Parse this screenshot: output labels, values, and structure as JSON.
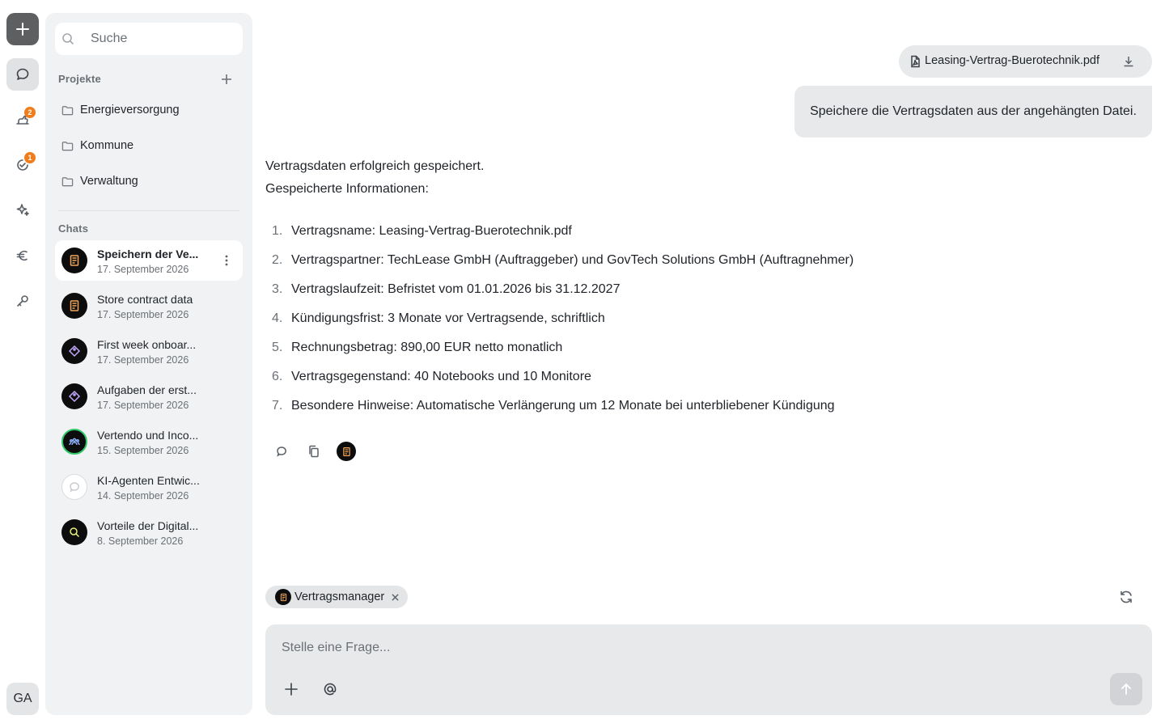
{
  "rail": {
    "badges": {
      "item2": "2",
      "item3": "1"
    },
    "user_initials": "GA"
  },
  "sidebar": {
    "search_placeholder": "Suche",
    "projects_title": "Projekte",
    "projects": [
      {
        "name": "Energieversorgung"
      },
      {
        "name": "Kommune"
      },
      {
        "name": "Verwaltung"
      }
    ],
    "chats_title": "Chats",
    "chats": [
      {
        "title": "Speichern der Ve...",
        "date": "17. September 2026",
        "icon": "contract-icon"
      },
      {
        "title": "Store contract data",
        "date": "17. September 2026",
        "icon": "contract-icon"
      },
      {
        "title": "First week onboar...",
        "date": "17. September 2026",
        "icon": "tag-icon"
      },
      {
        "title": "Aufgaben der erst...",
        "date": "17. September 2026",
        "icon": "tag-icon"
      },
      {
        "title": "Vertendo und Inco...",
        "date": "15. September 2026",
        "icon": "team-icon"
      },
      {
        "title": "KI-Agenten Entwic...",
        "date": "14. September 2026",
        "icon": "chat-icon"
      },
      {
        "title": "Vorteile der Digital...",
        "date": "8. September 2026",
        "icon": "magnifier-icon"
      }
    ]
  },
  "conversation": {
    "attachment_name": "Leasing-Vertrag-Buerotechnik.pdf",
    "user_message": "Speichere die Vertragsdaten aus der angehängten Datei.",
    "reply_line1": "Vertragsdaten erfolgreich gespeichert.",
    "reply_line2": "Gespeicherte Informationen:",
    "reply_items": [
      {
        "num": "1.",
        "text": "Vertragsname: Leasing-Vertrag-Buerotechnik.pdf"
      },
      {
        "num": "2.",
        "text": "Vertragspartner: TechLease GmbH (Auftraggeber) und GovTech Solutions GmbH (Auftragnehmer)"
      },
      {
        "num": "3.",
        "text": "Vertragslaufzeit: Befristet vom 01.01.2026 bis 31.12.2027"
      },
      {
        "num": "4.",
        "text": "Kündigungsfrist: 3 Monate vor Vertragsende, schriftlich"
      },
      {
        "num": "5.",
        "text": "Rechnungsbetrag: 890,00 EUR netto monatlich"
      },
      {
        "num": "6.",
        "text": "Vertragsgegenstand: 40 Notebooks und 10 Monitore"
      },
      {
        "num": "7.",
        "text": "Besondere Hinweise: Automatische Verlängerung um 12 Monate bei unterbliebener Kündigung"
      }
    ]
  },
  "composer": {
    "agent_label": "Vertragsmanager",
    "agent_remove": "×",
    "placeholder": "Stelle eine Frage..."
  },
  "colors": {
    "accent_badge": "#f07c1a",
    "agent_icon": "#f2a65a",
    "online_ring": "#31c86b"
  }
}
